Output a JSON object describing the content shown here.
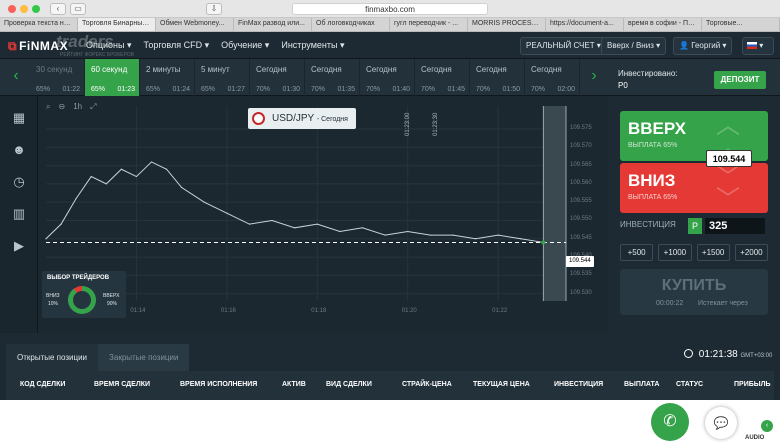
{
  "browser": {
    "url": "finmaxbo.com",
    "tabs": [
      "Проверка текста на...",
      "Торговля Бинарным...",
      "Обмен Webmoney...",
      "FinMax развод или...",
      "Об логовкодчиках",
      "гугл переводчик - ...",
      "MORRIS PROCESSI...",
      "https://document-a...",
      "время в софии - Пог...",
      "Торговые..."
    ]
  },
  "header": {
    "logo": "FiNMAX",
    "watermark": "traders",
    "watermark_sub": "РЕЙТИНГ ФОРЕКС БРОКЕРОВ",
    "menu": [
      "Опционы ▾",
      "Торговля CFD ▾",
      "Обучение ▾",
      "Инструменты ▾"
    ],
    "account": "РЕАЛЬНЫЙ СЧЕТ ▾",
    "mode": "Вверх / Вниз ▾",
    "user": "Георгий ▾"
  },
  "expiry": [
    {
      "label": "30 секунд",
      "pct": "65%",
      "time": "01:22",
      "state": "dim"
    },
    {
      "label": "60 секунд",
      "pct": "65%",
      "time": "01:23",
      "state": "active"
    },
    {
      "label": "2 минуты",
      "pct": "65%",
      "time": "01:24",
      "state": ""
    },
    {
      "label": "5 минут",
      "pct": "65%",
      "time": "01:27",
      "state": ""
    },
    {
      "label": "Сегодня",
      "pct": "70%",
      "time": "01:30",
      "state": ""
    },
    {
      "label": "Сегодня",
      "pct": "70%",
      "time": "01:35",
      "state": ""
    },
    {
      "label": "Сегодня",
      "pct": "70%",
      "time": "01:40",
      "state": ""
    },
    {
      "label": "Сегодня",
      "pct": "70%",
      "time": "01:45",
      "state": ""
    },
    {
      "label": "Сегодня",
      "pct": "70%",
      "time": "01:50",
      "state": ""
    },
    {
      "label": "Сегодня",
      "pct": "70%",
      "time": "02:00",
      "state": ""
    }
  ],
  "invest_panel": {
    "label": "Инвестировано:",
    "value": "Р0",
    "deposit": "ДЕПОЗИТ",
    "up_label": "ВВЕРХ",
    "up_payout": "ВЫПЛАТА 65%",
    "down_label": "ВНИЗ",
    "down_payout": "ВЫПЛАТА 65%",
    "current_price": "109.544",
    "investment_label": "ИНВЕСТИЦИЯ",
    "currency_sign": "Р",
    "amount": "325",
    "presets": [
      "+500",
      "+1000",
      "+1500",
      "+2000"
    ],
    "buy": "КУПИТЬ",
    "buy_time": "00:00:22",
    "buy_note": "Истекает через"
  },
  "chart": {
    "toolbar": [
      "⌕",
      "⊖",
      "1h",
      "⤢"
    ],
    "asset": "USD/JPY",
    "asset_sub": "- Сегодня",
    "expiry_mark_1": "01:23:00",
    "expiry_mark_2": "01:23:30",
    "current_label": "109.544",
    "y_ticks": [
      "109.575",
      "109.570",
      "109.565",
      "109.560",
      "109.555",
      "109.550",
      "109.545",
      "109.540",
      "109.535",
      "109.530"
    ],
    "x_ticks": [
      "01:14",
      "01:16",
      "01:18",
      "01:20",
      "01:22"
    ],
    "traders_title": "ВЫБОР ТРЕЙДЕРОВ",
    "traders_down": "ВНИЗ",
    "traders_down_pct": "10%",
    "traders_up": "ВВЕРХ",
    "traders_up_pct": "90%"
  },
  "chart_data": {
    "type": "line",
    "title": "USD/JPY - Сегодня",
    "xlabel": "",
    "ylabel": "",
    "x_range": [
      "01:12",
      "01:23:30"
    ],
    "ylim": [
      109.528,
      109.578
    ],
    "current_value": 109.544,
    "trader_choice": {
      "down": 10,
      "up": 90
    },
    "x": [
      "01:12:00",
      "01:12:20",
      "01:12:40",
      "01:13:00",
      "01:13:20",
      "01:13:40",
      "01:14:00",
      "01:14:20",
      "01:14:40",
      "01:15:00",
      "01:15:30",
      "01:16:00",
      "01:16:30",
      "01:17:00",
      "01:17:30",
      "01:18:00",
      "01:18:30",
      "01:19:00",
      "01:19:30",
      "01:20:00",
      "01:20:30",
      "01:21:00",
      "01:21:30",
      "01:22:00",
      "01:22:30",
      "01:23:00"
    ],
    "y": [
      109.545,
      109.549,
      109.556,
      109.562,
      109.56,
      109.564,
      109.562,
      109.566,
      109.564,
      109.559,
      109.555,
      109.552,
      109.549,
      109.55,
      109.548,
      109.549,
      109.547,
      109.548,
      109.546,
      109.547,
      109.546,
      109.546,
      109.545,
      109.546,
      109.545,
      109.544
    ]
  },
  "positions": {
    "tab_open": "Открытые позиции",
    "tab_closed": "Закрытые позиции",
    "clock": "01:21:38",
    "timezone": "GMT+03:00",
    "columns": [
      "КОД СДЕЛКИ",
      "ВРЕМЯ СДЕЛКИ",
      "ВРЕМЯ ИСПОЛНЕНИЯ",
      "АКТИВ",
      "ВИД СДЕЛКИ",
      "СТРАЙК-ЦЕНА",
      "ТЕКУЩАЯ ЦЕНА",
      "ИНВЕСТИЦИЯ",
      "ВЫПЛАТА",
      "СТАТУС",
      "ПРИБЫЛЬ"
    ]
  },
  "widgets": {
    "audio": "AUDIO"
  },
  "colors": {
    "accent_green": "#35a34a",
    "accent_red": "#e53935",
    "panel": "#1d2a33"
  }
}
